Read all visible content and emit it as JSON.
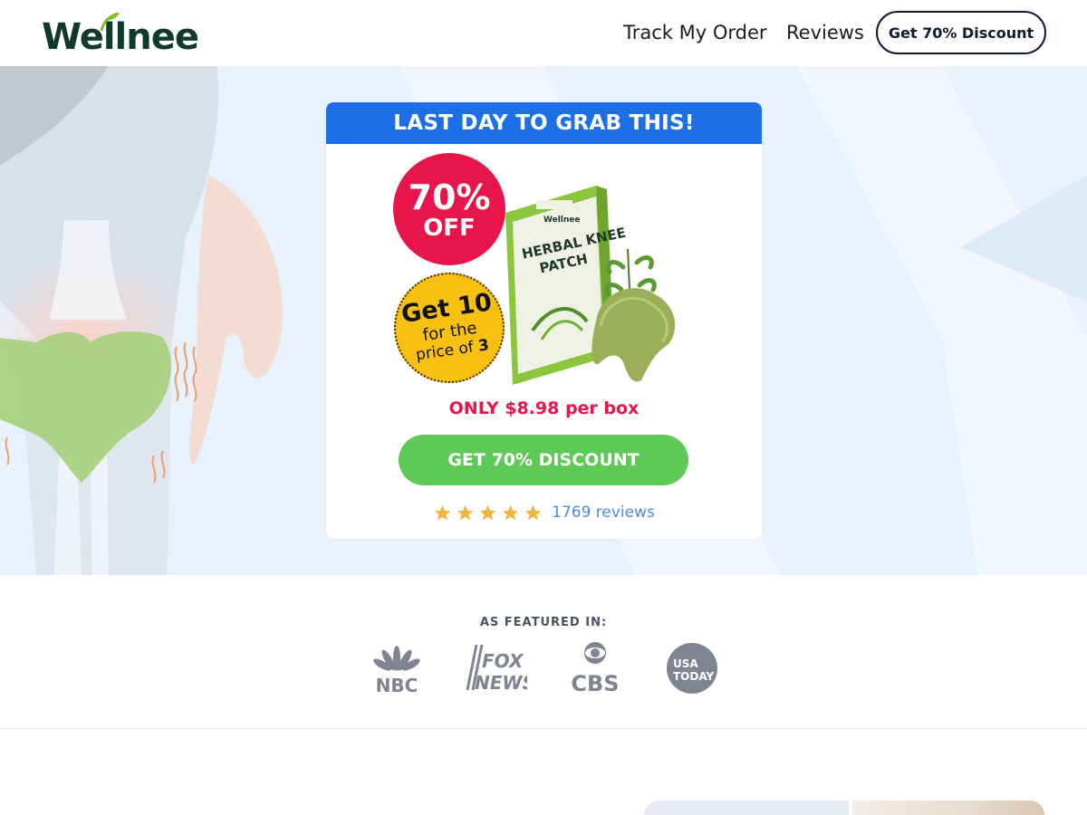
{
  "header": {
    "logo_text": "Wellnee",
    "nav": {
      "track_order": "Track My Order",
      "reviews": "Reviews",
      "discount_button": "Get 70% Discount"
    }
  },
  "offer": {
    "banner": "LAST DAY TO GRAB THIS!",
    "badge_off": {
      "percent": "70%",
      "label": "OFF"
    },
    "badge_deal": {
      "line1": "Get 10",
      "line2": "for the",
      "line3_prefix": "price of",
      "line3_value": "3"
    },
    "product": {
      "brand": "Wellnee",
      "name_line1": "HERBAL KNEE",
      "name_line2": "PATCH"
    },
    "price": "ONLY $8.98 per box",
    "cta": "GET 70% DISCOUNT",
    "rating": {
      "stars": 5,
      "reviews": "1769 reviews"
    }
  },
  "featured": {
    "title": "AS FEATURED IN:",
    "logos": {
      "nbc": "NBC",
      "fox_line1": "FOX",
      "fox_line2": "NEWS",
      "cbs": "CBS",
      "usa_line1": "USA",
      "usa_line2": "TODAY"
    }
  },
  "colors": {
    "brand_dark": "#0f3a2c",
    "banner_blue": "#1d6fe6",
    "badge_red": "#e8154b",
    "badge_yellow": "#f8c112",
    "cta_green": "#5ec957",
    "star": "#f2b441",
    "link_blue": "#4a8fd8",
    "media_gray": "#7e8491"
  },
  "icons": [
    "leaf-icon",
    "star-icon",
    "nbc-peacock-icon",
    "cbs-eye-icon"
  ]
}
